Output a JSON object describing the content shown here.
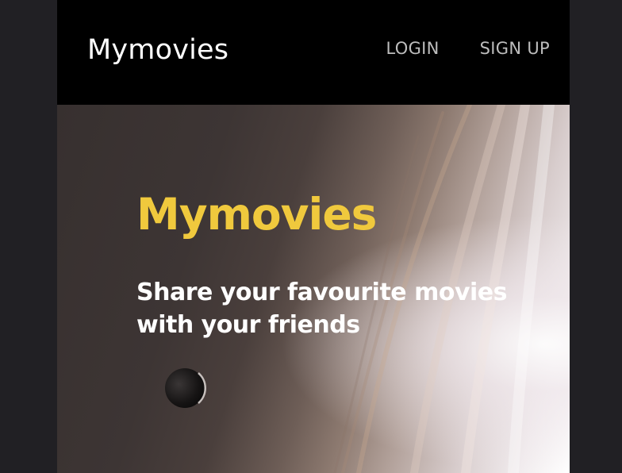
{
  "navbar": {
    "brand": "Mymovies",
    "login_label": "LOGIN",
    "signup_label": "SIGN UP"
  },
  "hero": {
    "title": "Mymovies",
    "subtitle": "Share your favourite movies with your friends",
    "background_image": "planet-with-moon"
  },
  "colors": {
    "page_bg": "#212024",
    "navbar_bg": "#000000",
    "brand_text": "#ffffff",
    "nav_text": "#bdbdbd",
    "accent_yellow": "#f0c93d",
    "subtitle_text": "#ffffff"
  }
}
